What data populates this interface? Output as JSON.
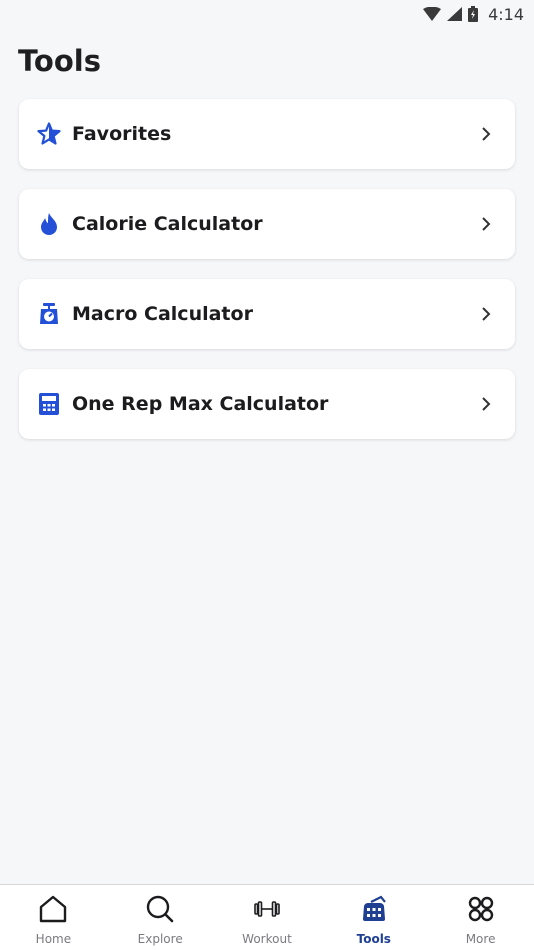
{
  "status_bar": {
    "time": "4:14",
    "icons": [
      "wifi-icon",
      "signal-icon",
      "battery-icon"
    ]
  },
  "page": {
    "title": "Tools"
  },
  "tools": [
    {
      "label": "Favorites",
      "icon": "star-icon"
    },
    {
      "label": "Calorie Calculator",
      "icon": "flame-icon"
    },
    {
      "label": "Macro Calculator",
      "icon": "scale-icon"
    },
    {
      "label": "One Rep Max Calculator",
      "icon": "calculator-icon"
    }
  ],
  "bottom_nav": [
    {
      "label": "Home",
      "icon": "home-icon",
      "active": false
    },
    {
      "label": "Explore",
      "icon": "search-icon",
      "active": false
    },
    {
      "label": "Workout",
      "icon": "dumbbell-icon",
      "active": false
    },
    {
      "label": "Tools",
      "icon": "tools-icon",
      "active": true
    },
    {
      "label": "More",
      "icon": "grid-icon",
      "active": false
    }
  ],
  "colors": {
    "accent": "#2350d6",
    "active_nav": "#1f3f93",
    "background": "#f6f7f9"
  }
}
